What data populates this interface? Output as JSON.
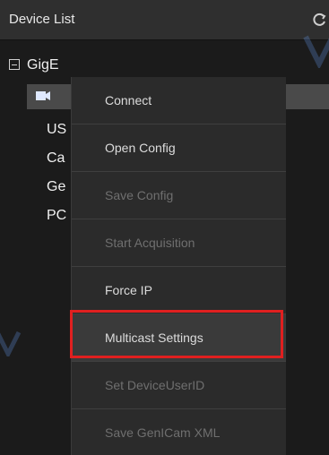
{
  "panel": {
    "title": "Device List",
    "icons": {
      "refresh": "refresh-icon",
      "camera": "camera-icon"
    }
  },
  "tree": {
    "root_label": "GigE",
    "children": [
      "US",
      "Ca",
      "Ge",
      "PC"
    ]
  },
  "context_menu": {
    "items": [
      {
        "label": "Connect",
        "enabled": true
      },
      {
        "label": "Open Config",
        "enabled": true
      },
      {
        "label": "Save Config",
        "enabled": false
      },
      {
        "label": "Start Acquisition",
        "enabled": false
      },
      {
        "label": "Force IP",
        "enabled": true
      },
      {
        "label": "Multicast Settings",
        "enabled": true,
        "highlighted": true
      },
      {
        "label": "Set DeviceUserID",
        "enabled": false
      },
      {
        "label": "Save GenICam XML",
        "enabled": false
      }
    ]
  },
  "colors": {
    "highlight_border": "#e02020",
    "panel_bg": "#1b1b1b",
    "menu_bg": "#2b2b2b",
    "header_bg": "#2f2f2f"
  }
}
